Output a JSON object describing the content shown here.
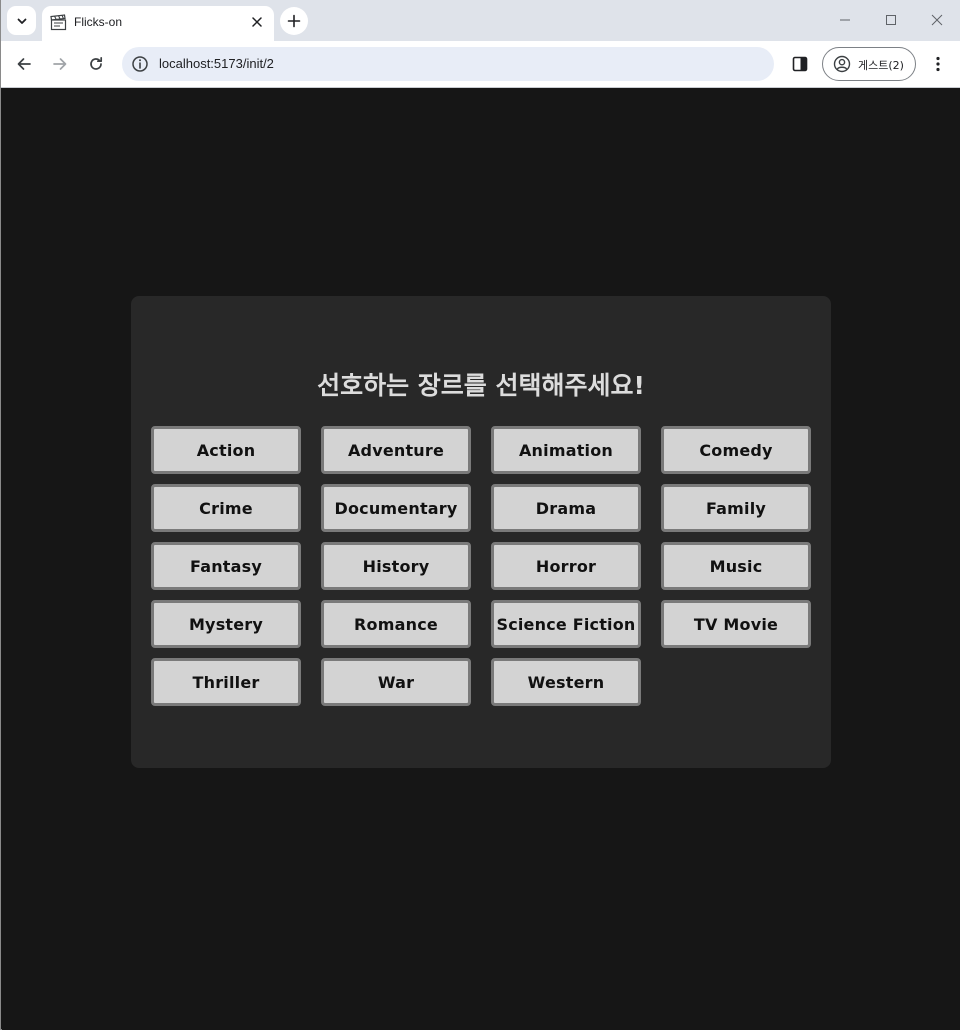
{
  "browser": {
    "tab_title": "Flicks-on",
    "url": "localhost:5173/init/2",
    "profile_label": "게스트(2)"
  },
  "page": {
    "title": "선호하는 장르를 선택해주세요!",
    "genres": [
      "Action",
      "Adventure",
      "Animation",
      "Comedy",
      "Crime",
      "Documentary",
      "Drama",
      "Family",
      "Fantasy",
      "History",
      "Horror",
      "Music",
      "Mystery",
      "Romance",
      "Science Fiction",
      "TV Movie",
      "Thriller",
      "War",
      "Western"
    ]
  }
}
